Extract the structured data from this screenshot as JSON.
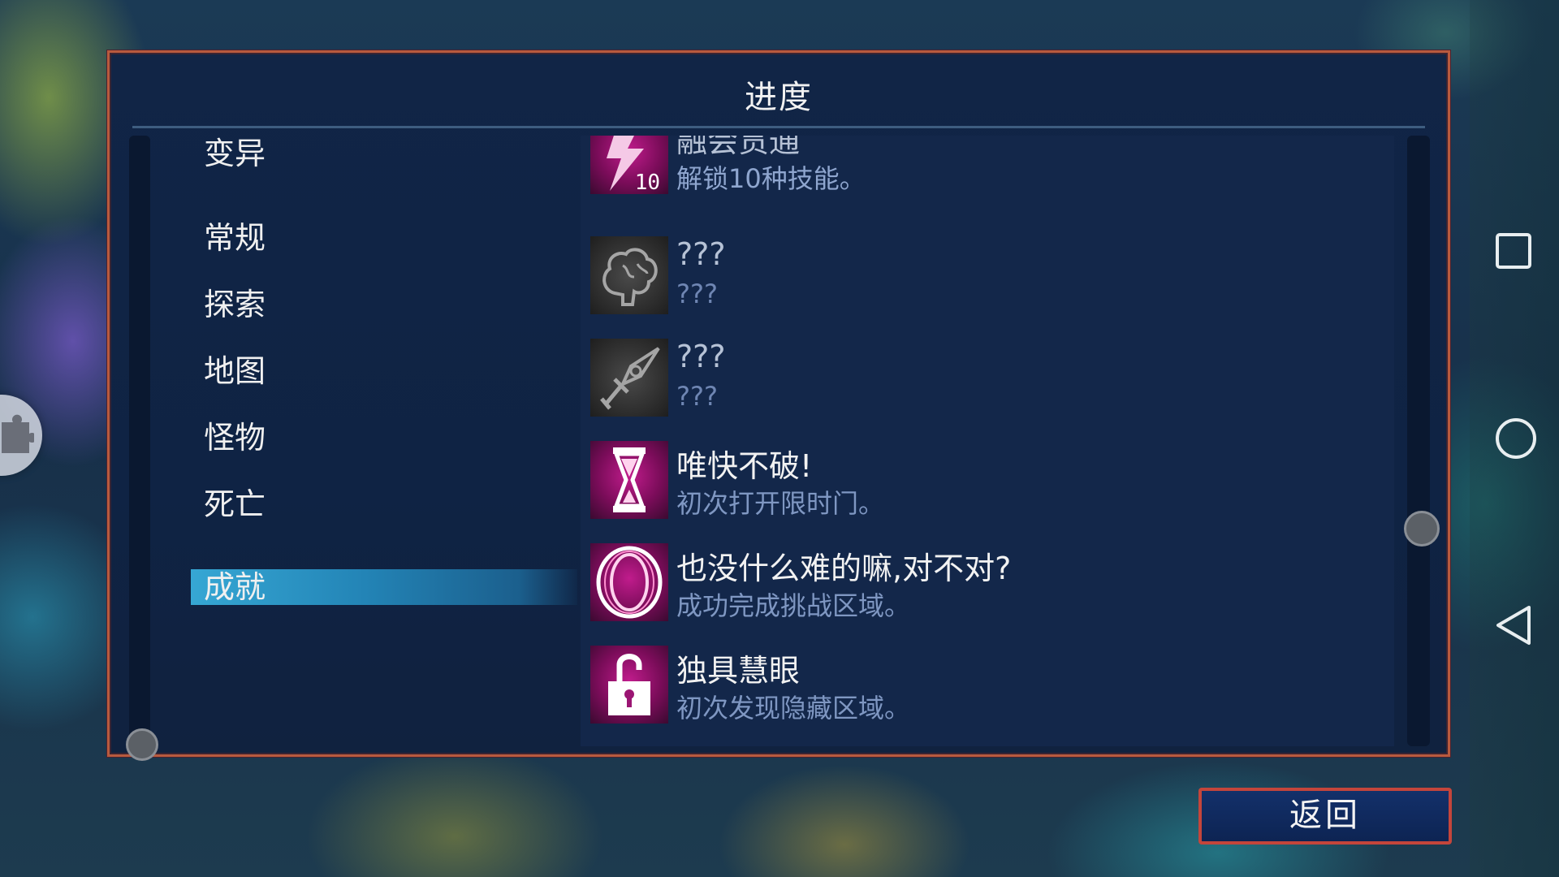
{
  "panel": {
    "title": "进度"
  },
  "categories": [
    {
      "label": "变异"
    },
    {
      "label": "常规"
    },
    {
      "label": "探索"
    },
    {
      "label": "地图"
    },
    {
      "label": "怪物"
    },
    {
      "label": "死亡"
    },
    {
      "label": "成就",
      "selected": true
    }
  ],
  "achievements": [
    {
      "title": "融会贯通",
      "description": "解锁10种技能。",
      "icon": "lightning-10-icon",
      "badge": "10",
      "locked": false
    },
    {
      "title": "???",
      "description": "???",
      "icon": "brain-icon",
      "locked": true
    },
    {
      "title": "???",
      "description": "???",
      "icon": "sword-icon",
      "locked": true
    },
    {
      "title": "唯快不破!",
      "description": "初次打开限时门。",
      "icon": "hourglass-icon",
      "locked": false
    },
    {
      "title": "也没什么难的嘛,对不对?",
      "description": "成功完成挑战区域。",
      "icon": "portal-ring-icon",
      "locked": false
    },
    {
      "title": "独具慧眼",
      "description": "初次发现隐藏区域。",
      "icon": "unlock-padlock-icon",
      "locked": false
    }
  ],
  "footer": {
    "back_label": "返回"
  },
  "colors": {
    "accent": "#2a8fc4",
    "frame": "#b85a3e",
    "unlocked_icon": "#c01c8c"
  }
}
